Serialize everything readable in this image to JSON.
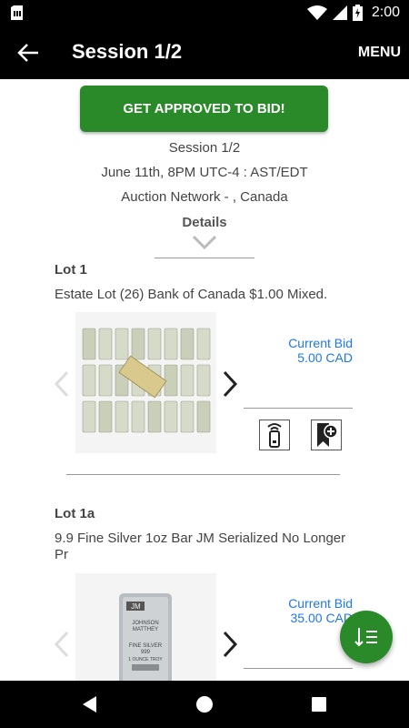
{
  "status_bar": {
    "time": "2:00",
    "icons": [
      "sim-card-icon",
      "wifi-icon",
      "cell-signal-icon",
      "battery-charging-icon"
    ]
  },
  "app_bar": {
    "title": "Session 1/2",
    "menu_label": "MENU",
    "back_icon": "back-arrow-icon"
  },
  "session": {
    "approve_button": "GET APPROVED TO BID!",
    "name": "Session 1/2",
    "date": "June 11th, 8PM UTC-4 : AST/EDT",
    "location": "Auction Network - , Canada",
    "details_label": "Details"
  },
  "lots": [
    {
      "number": "Lot 1",
      "description": "Estate Lot (26) Bank of Canada $1.00 Mixed.",
      "current_bid_label": "Current Bid",
      "current_bid_value": "5.00 CAD"
    },
    {
      "number": "Lot 1a",
      "description": "9.9 Fine Silver 1oz Bar JM Serialized No Longer Pr",
      "current_bid_label": "Current Bid",
      "current_bid_value": "35.00 CAD",
      "bar_text": {
        "brand_line1": "JOHNSON",
        "brand_line2": "MATTHEY",
        "fine": "FINE SILVER",
        "purity": "999",
        "weight": "1 OUNCE TROY"
      }
    }
  ],
  "colors": {
    "accent_green": "#2a8a2a",
    "bid_blue": "#1e78e6",
    "bar_black": "#000000"
  },
  "nav": {
    "icons": [
      "nav-back-icon",
      "nav-home-icon",
      "nav-recents-icon"
    ]
  }
}
